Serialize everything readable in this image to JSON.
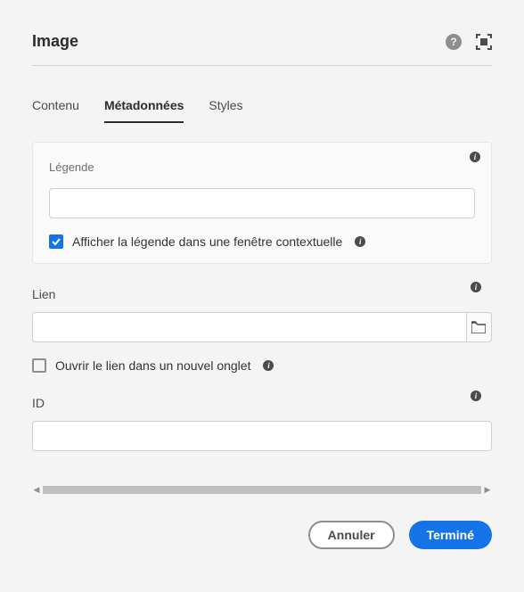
{
  "header": {
    "title": "Image"
  },
  "tabs": {
    "items": [
      {
        "label": "Contenu"
      },
      {
        "label": "Métadonnées"
      },
      {
        "label": "Styles"
      }
    ]
  },
  "caption": {
    "label": "Légende",
    "value": "",
    "popup_checked": true,
    "popup_label": "Afficher la légende dans une fenêtre contextuelle"
  },
  "link": {
    "label": "Lien",
    "value": "",
    "newtab_checked": false,
    "newtab_label": "Ouvrir le lien dans un nouvel onglet"
  },
  "id": {
    "label": "ID",
    "value": ""
  },
  "footer": {
    "cancel": "Annuler",
    "done": "Terminé"
  }
}
